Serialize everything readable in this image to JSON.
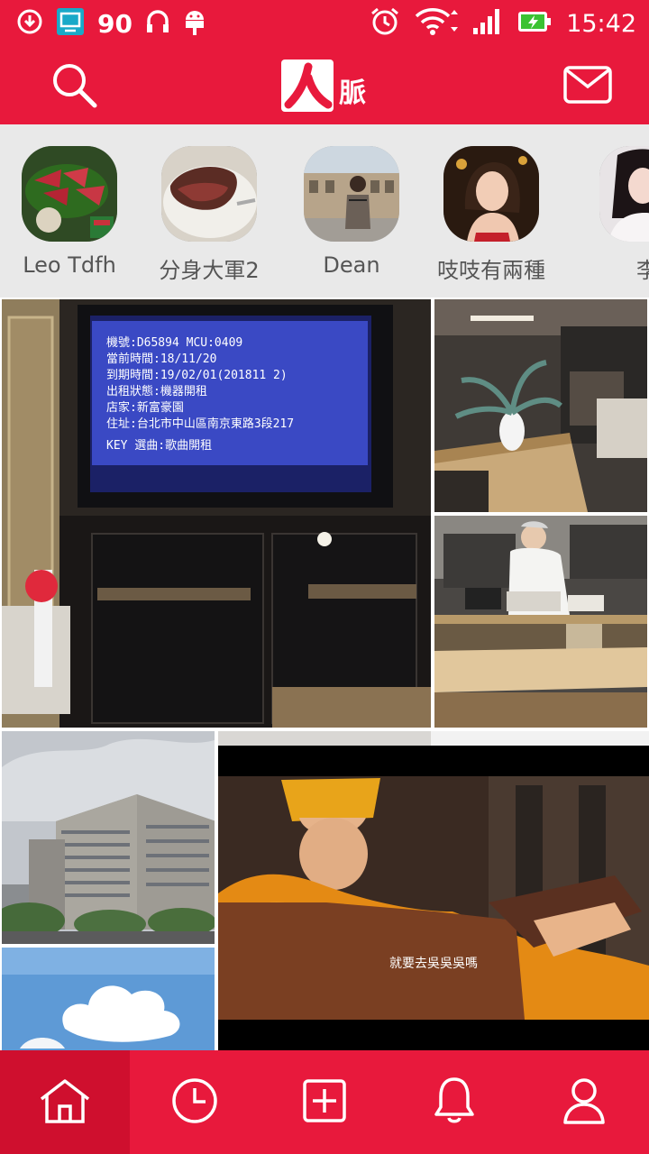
{
  "status_bar": {
    "signal_number": "90",
    "time": "15:42",
    "icons": [
      "download-icon",
      "cast-icon",
      "headset-icon",
      "android-icon",
      "alarm-icon",
      "wifi-icon",
      "cell-signal-icon",
      "battery-charging-icon"
    ]
  },
  "header": {
    "logo_text": "脈",
    "left_icon": "search-icon",
    "right_icon": "mail-icon"
  },
  "stories": [
    {
      "name": "Leo Tdfh"
    },
    {
      "name": "分身大軍2"
    },
    {
      "name": "Dean"
    },
    {
      "name": "吱吱有兩種"
    },
    {
      "name": "李"
    }
  ],
  "photos": {
    "karaoke_screen_lines": [
      "機號:D65894  MCU:0409",
      "當前時間:18/11/20",
      "到期時間:19/02/01(201811 2)",
      "出租狀態:機器開租",
      "店家:新富豪園",
      "住址:台北市中山區南京東路3段217",
      "KEY 選曲:歌曲開租"
    ],
    "video_subtitle": "就要去吳吳吳嗎"
  },
  "bottom_nav": [
    {
      "icon": "home-icon",
      "active": true
    },
    {
      "icon": "history-clock-icon",
      "active": false
    },
    {
      "icon": "add-post-icon",
      "active": false
    },
    {
      "icon": "notification-bell-icon",
      "active": false
    },
    {
      "icon": "profile-icon",
      "active": false
    }
  ],
  "colors": {
    "brand_red": "#e8193c",
    "brand_red_dark": "#cf0f2e",
    "strip_bg": "#e9e9e9"
  }
}
